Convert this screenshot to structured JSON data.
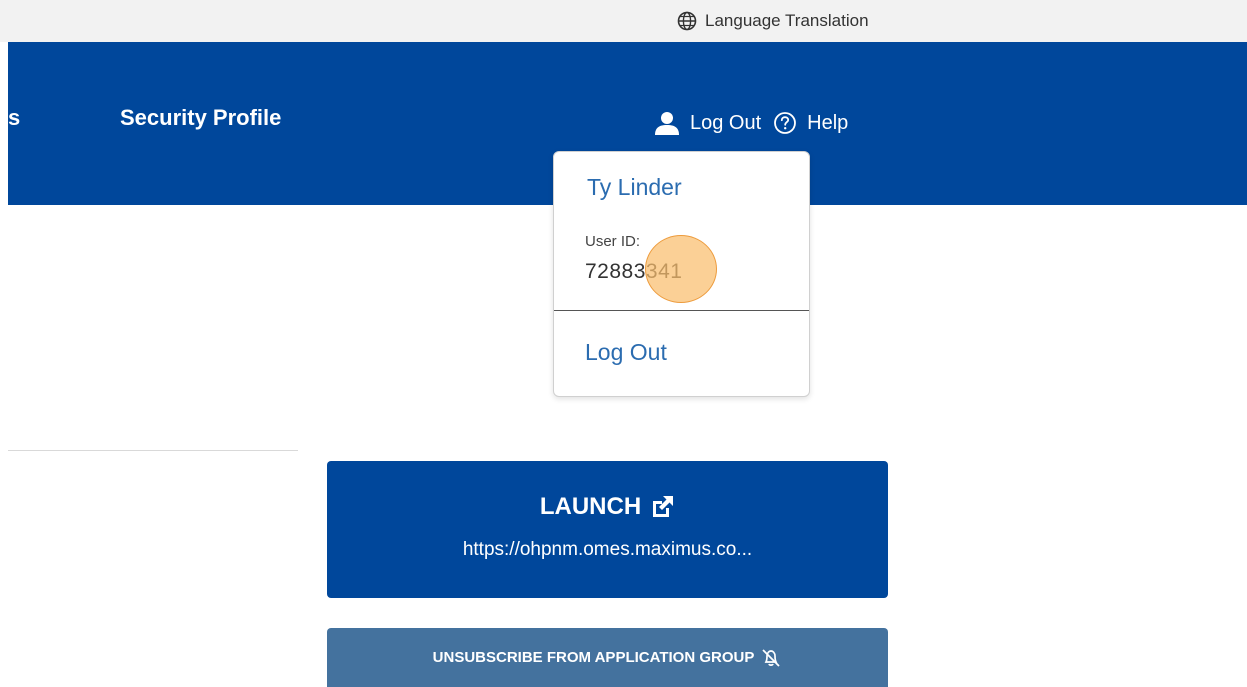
{
  "utility": {
    "language_label": "Language Translation",
    "language_icon": "globe-icon"
  },
  "header": {
    "nav_partial": "s",
    "nav_security_profile": "Security Profile",
    "user_icon": "user-icon",
    "logout_label": "Log Out",
    "help_icon": "question-circle-icon",
    "help_label": "Help"
  },
  "user_dropdown": {
    "name": "Ty Linder",
    "user_id_label": "User ID:",
    "user_id_value": "72883341",
    "logout_label": "Log Out"
  },
  "launch_card": {
    "title": "LAUNCH",
    "icon": "external-link-icon",
    "url": "https://ohpnm.omes.maximus.co..."
  },
  "unsubscribe": {
    "label": "UNSUBSCRIBE FROM APPLICATION GROUP",
    "icon": "bell-off-icon"
  },
  "colors": {
    "primary_blue": "#00479b",
    "secondary_blue": "#44729e",
    "link_blue": "#2b6cb0",
    "utility_bg": "#f2f2f2"
  }
}
